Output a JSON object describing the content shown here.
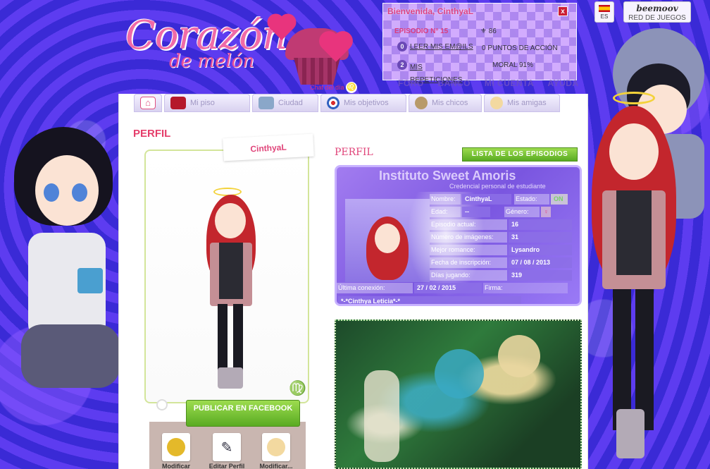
{
  "header": {
    "logo_text": "Corazón",
    "logo_sub": "de melón",
    "chat_label": "Chat del día",
    "lang": "ES",
    "beemoov_brand": "beemoov",
    "beemoov_label": "RED DE JUEGOS",
    "top_links": [
      "FORO",
      "BANCO",
      "MI CUENTA",
      "AYUDA"
    ]
  },
  "welcome": {
    "title": "Bienvenida, CinthyaL",
    "close": "x",
    "episode_label": "EPISODIO N° 15",
    "coins": "86",
    "mails_badge": "0",
    "mails_label": "LEER MIS EM@ILS",
    "action_points": "0 PUNTOS DE ACCIÓN",
    "reps_badge": "2",
    "reps_label": "MIS REPETICIONES",
    "moral": "MORAL 91%"
  },
  "nav": [
    {
      "label": "",
      "icon": "home-icon"
    },
    {
      "label": "Mi piso",
      "icon": "sofa-icon"
    },
    {
      "label": "Ciudad",
      "icon": "building-icon"
    },
    {
      "label": "Mis objetivos",
      "icon": "target-icon"
    },
    {
      "label": "Mis chicos",
      "icon": "boy-icon"
    },
    {
      "label": "Mis amigas",
      "icon": "girl-icon"
    }
  ],
  "page": {
    "title": "PERFIL",
    "username": "CinthyaL",
    "zodiac": "♍",
    "facebook_btn": "PUBLICAR EN FACEBOOK",
    "actions": [
      "Modificar mi...",
      "Editar Perfil",
      "Modificar..."
    ]
  },
  "profile": {
    "header": "PERFIL",
    "episodes_btn": "LISTA DE LOS EPISODIOS",
    "card_title": "Instituto Sweet Amoris",
    "card_sub": "Credencial personal de estudiante",
    "name_lbl": "Nombre:",
    "name_val": "CinthyaL",
    "state_lbl": "Estado:",
    "state_val": "ON",
    "age_lbl": "Edad:",
    "age_val": "--",
    "gender_lbl": "Género:",
    "gender_val": "♀",
    "episode_lbl": "Episodio actual:",
    "episode_val": "16",
    "images_lbl": "Número de imágenes:",
    "images_val": "31",
    "best_lbl": "Mejor romance:",
    "best_val": "Lysandro",
    "signup_lbl": "Fecha de inscripción:",
    "signup_val": "07 / 08 / 2013",
    "days_lbl": "Días jugando:",
    "days_val": "319",
    "last_lbl": "Última conexión:",
    "last_val": "27 / 02 / 2015",
    "sign_lbl": "Firma:",
    "motto": "*-*Cinthya Leticia*-*"
  }
}
